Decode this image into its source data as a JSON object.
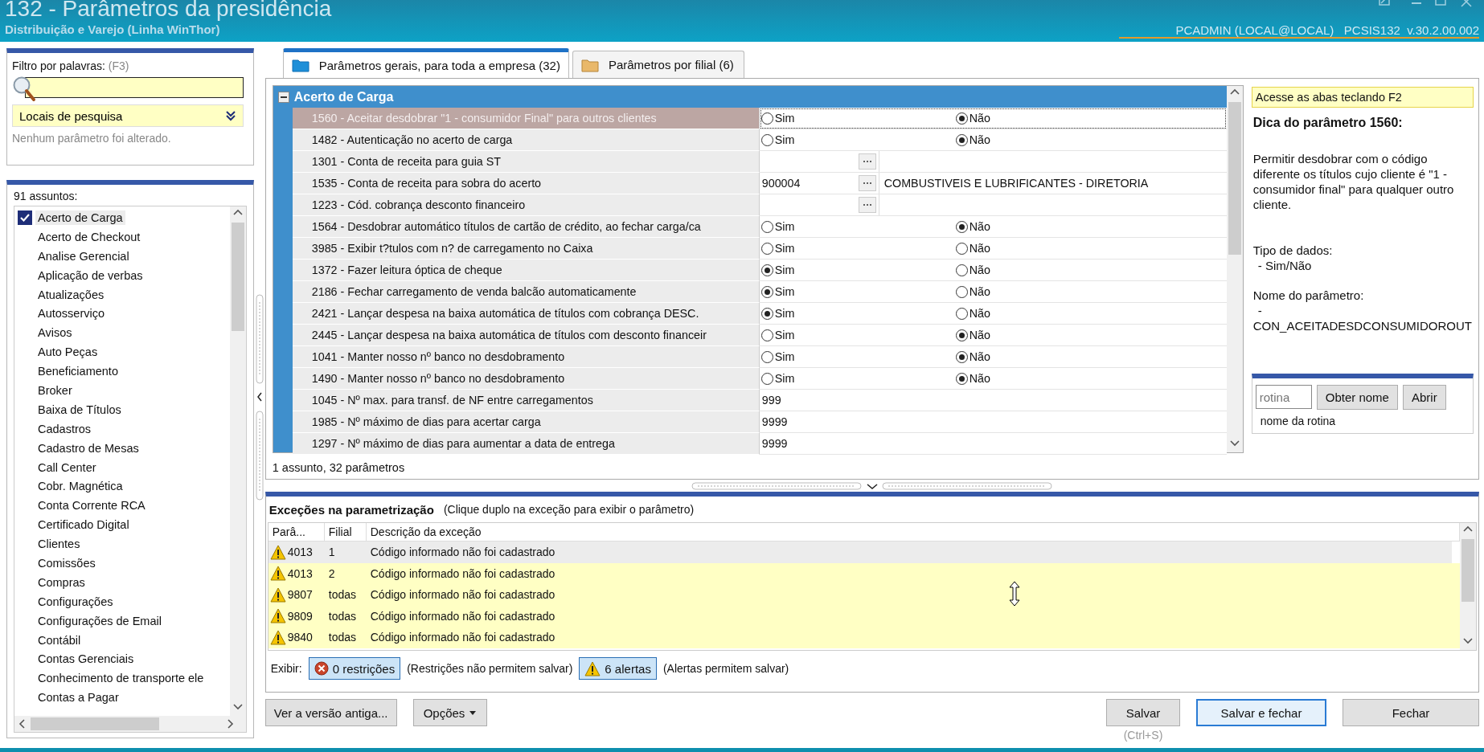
{
  "window": {
    "title": "132 - Parâmetros da presidência",
    "subtitle": "Distribuição e Varejo (Linha WinThor)",
    "session": "PCADMIN (LOCAL@LOCAL)   PCSIS132  v.30.2.00.002"
  },
  "filter": {
    "label": "Filtro por palavras:",
    "shortcut": "(F3)",
    "locations": "Locais de pesquisa",
    "status": "Nenhum parâmetro foi alterado."
  },
  "subjects": {
    "count_label": "91 assuntos:",
    "items": [
      {
        "label": "Acerto de Carga",
        "checked": true,
        "selected": true
      },
      {
        "label": "Acerto de Checkout",
        "checked": false,
        "selected": false
      },
      {
        "label": "Analise Gerencial",
        "checked": false,
        "selected": false
      },
      {
        "label": "Aplicação de verbas",
        "checked": false,
        "selected": false
      },
      {
        "label": "Atualizações",
        "checked": false,
        "selected": false
      },
      {
        "label": "Autosserviço",
        "checked": false,
        "selected": false
      },
      {
        "label": "Avisos",
        "checked": false,
        "selected": false
      },
      {
        "label": "Auto Peças",
        "checked": false,
        "selected": false
      },
      {
        "label": "Beneficiamento",
        "checked": false,
        "selected": false
      },
      {
        "label": "Broker",
        "checked": false,
        "selected": false
      },
      {
        "label": "Baixa de Títulos",
        "checked": false,
        "selected": false
      },
      {
        "label": "Cadastros",
        "checked": false,
        "selected": false
      },
      {
        "label": "Cadastro de Mesas",
        "checked": false,
        "selected": false
      },
      {
        "label": "Call Center",
        "checked": false,
        "selected": false
      },
      {
        "label": "Cobr. Magnética",
        "checked": false,
        "selected": false
      },
      {
        "label": "Conta Corrente RCA",
        "checked": false,
        "selected": false
      },
      {
        "label": "Certificado Digital",
        "checked": false,
        "selected": false
      },
      {
        "label": "Clientes",
        "checked": false,
        "selected": false
      },
      {
        "label": "Comissões",
        "checked": false,
        "selected": false
      },
      {
        "label": "Compras",
        "checked": false,
        "selected": false
      },
      {
        "label": "Configurações",
        "checked": false,
        "selected": false
      },
      {
        "label": "Configurações de Email",
        "checked": false,
        "selected": false
      },
      {
        "label": "Contábil",
        "checked": false,
        "selected": false
      },
      {
        "label": "Contas Gerenciais",
        "checked": false,
        "selected": false
      },
      {
        "label": "Conhecimento de transporte ele",
        "checked": false,
        "selected": false
      },
      {
        "label": "Contas a Pagar",
        "checked": false,
        "selected": false
      }
    ]
  },
  "tabs": [
    {
      "label": "Parâmetros gerais, para toda a empresa  (32)",
      "selected": true
    },
    {
      "label": "Parâmetros por filial  (6)",
      "selected": false
    }
  ],
  "params": {
    "group": {
      "title": "Acerto de Carga",
      "expanded": true
    },
    "rows": [
      {
        "label": "1560 - Aceitar desdobrar \"1 - consumidor Final\" para outros clientes",
        "kind": "radio",
        "selected": true,
        "options": [
          {
            "label": "Sim",
            "selected": false
          },
          {
            "label": "Não",
            "selected": true
          }
        ]
      },
      {
        "label": "1482 - Autenticação no acerto de carga",
        "kind": "radio",
        "selected": false,
        "options": [
          {
            "label": "Sim",
            "selected": false
          },
          {
            "label": "Não",
            "selected": true
          }
        ]
      },
      {
        "label": "1301 - Conta de receita para guia ST",
        "kind": "lookup",
        "selected": false
      },
      {
        "label": "1535 - Conta de receita para sobra do acerto",
        "kind": "lookup",
        "selected": false,
        "value": "900004",
        "description": "COMBUSTIVEIS E LUBRIFICANTES - DIRETORIA"
      },
      {
        "label": "1223 - Cód. cobrança desconto financeiro",
        "kind": "lookup",
        "selected": false
      },
      {
        "label": "1564 - Desdobrar automático títulos de cartão de crédito, ao fechar carga/ca",
        "kind": "radio",
        "selected": false,
        "options": [
          {
            "label": "Sim",
            "selected": false
          },
          {
            "label": "Não",
            "selected": true
          }
        ]
      },
      {
        "label": "3985 - Exibir t?tulos com n? de carregamento no Caixa",
        "kind": "radio",
        "selected": false,
        "options": [
          {
            "label": "Sim",
            "selected": false
          },
          {
            "label": "Não",
            "selected": false
          }
        ]
      },
      {
        "label": "1372 - Fazer leitura óptica de cheque",
        "kind": "radio",
        "selected": false,
        "options": [
          {
            "label": "Sim",
            "selected": true
          },
          {
            "label": "Não",
            "selected": false
          }
        ]
      },
      {
        "label": "2186 - Fechar carregamento de venda balcão automaticamente",
        "kind": "radio",
        "selected": false,
        "options": [
          {
            "label": "Sim",
            "selected": true
          },
          {
            "label": "Não",
            "selected": false
          }
        ]
      },
      {
        "label": "2421 - Lançar despesa na baixa automática de títulos com cobrança DESC.",
        "kind": "radio",
        "selected": false,
        "options": [
          {
            "label": "Sim",
            "selected": true
          },
          {
            "label": "Não",
            "selected": false
          }
        ]
      },
      {
        "label": "2445 - Lançar despesa na baixa automática de títulos com desconto financeir",
        "kind": "radio",
        "selected": false,
        "options": [
          {
            "label": "Sim",
            "selected": false
          },
          {
            "label": "Não",
            "selected": true
          }
        ]
      },
      {
        "label": "1041 - Manter nosso nº banco no desdobramento",
        "kind": "radio",
        "selected": false,
        "options": [
          {
            "label": "Sim",
            "selected": false
          },
          {
            "label": "Não",
            "selected": true
          }
        ]
      },
      {
        "label": "1490 - Manter nosso nº banco no desdobramento",
        "kind": "radio",
        "selected": false,
        "options": [
          {
            "label": "Sim",
            "selected": false
          },
          {
            "label": "Não",
            "selected": true
          }
        ]
      },
      {
        "label": "1045 - Nº max. para transf. de NF entre carregamentos",
        "kind": "text",
        "selected": false,
        "value": "999"
      },
      {
        "label": "1985 - Nº máximo de dias para acertar carga",
        "kind": "text",
        "selected": false,
        "value": "9999"
      },
      {
        "label": "1297 - Nº máximo de dias para aumentar a data de entrega",
        "kind": "text",
        "selected": false,
        "value": "9999"
      }
    ],
    "summary": "1 assunto, 32 parâmetros"
  },
  "tip": {
    "hint": "Acesse as abas teclando F2",
    "title": "Dica do parâmetro 1560:",
    "text": "Permitir desdobrar com o código diferente os títulos cujo cliente é \"1 - consumidor final\" para qualquer outro cliente.",
    "type_label": "Tipo de dados:",
    "type_value": "- Sim/Não",
    "name_label": "Nome do parâmetro:",
    "name_dash": "-",
    "name_value": "CON_ACEITADESDCONSUMIDOROUT"
  },
  "routine": {
    "placeholder": "rotina",
    "buttons": [
      "Obter nome",
      "Abrir"
    ],
    "caption": "nome da rotina"
  },
  "exceptions": {
    "title": "Exceções na parametrização",
    "hint": "(Clique duplo na exceção para exibir o parâmetro)",
    "columns": [
      "Parâ...",
      "Filial",
      "Descrição da exceção"
    ],
    "rows": [
      {
        "param": "4013",
        "branch": "1",
        "description": "Código informado não foi cadastrado",
        "selected": true
      },
      {
        "param": "4013",
        "branch": "2",
        "description": "Código informado não foi cadastrado",
        "selected": false
      },
      {
        "param": "9807",
        "branch": "todas",
        "description": "Código informado não foi cadastrado",
        "selected": false
      },
      {
        "param": "9809",
        "branch": "todas",
        "description": "Código informado não foi cadastrado",
        "selected": false
      },
      {
        "param": "9840",
        "branch": "todas",
        "description": "Código informado não foi cadastrado",
        "selected": false
      }
    ],
    "show_label": "Exibir:",
    "toggles": [
      {
        "kind": "error",
        "label": "0 restrições",
        "note": "(Restrições não permitem salvar)",
        "selected": true
      },
      {
        "kind": "warning",
        "label": "6 alertas",
        "note": "(Alertas permitem salvar)",
        "selected": true
      }
    ]
  },
  "actions": {
    "left": [
      {
        "label": "Ver a versão antiga...",
        "menu": false
      },
      {
        "label": "Opções",
        "menu": true
      }
    ],
    "right": [
      {
        "label": "Salvar",
        "focused": false,
        "shortcut": "(Ctrl+S)"
      },
      {
        "label": "Salvar e fechar",
        "focused": true
      },
      {
        "label": "Fechar",
        "focused": false
      }
    ]
  }
}
